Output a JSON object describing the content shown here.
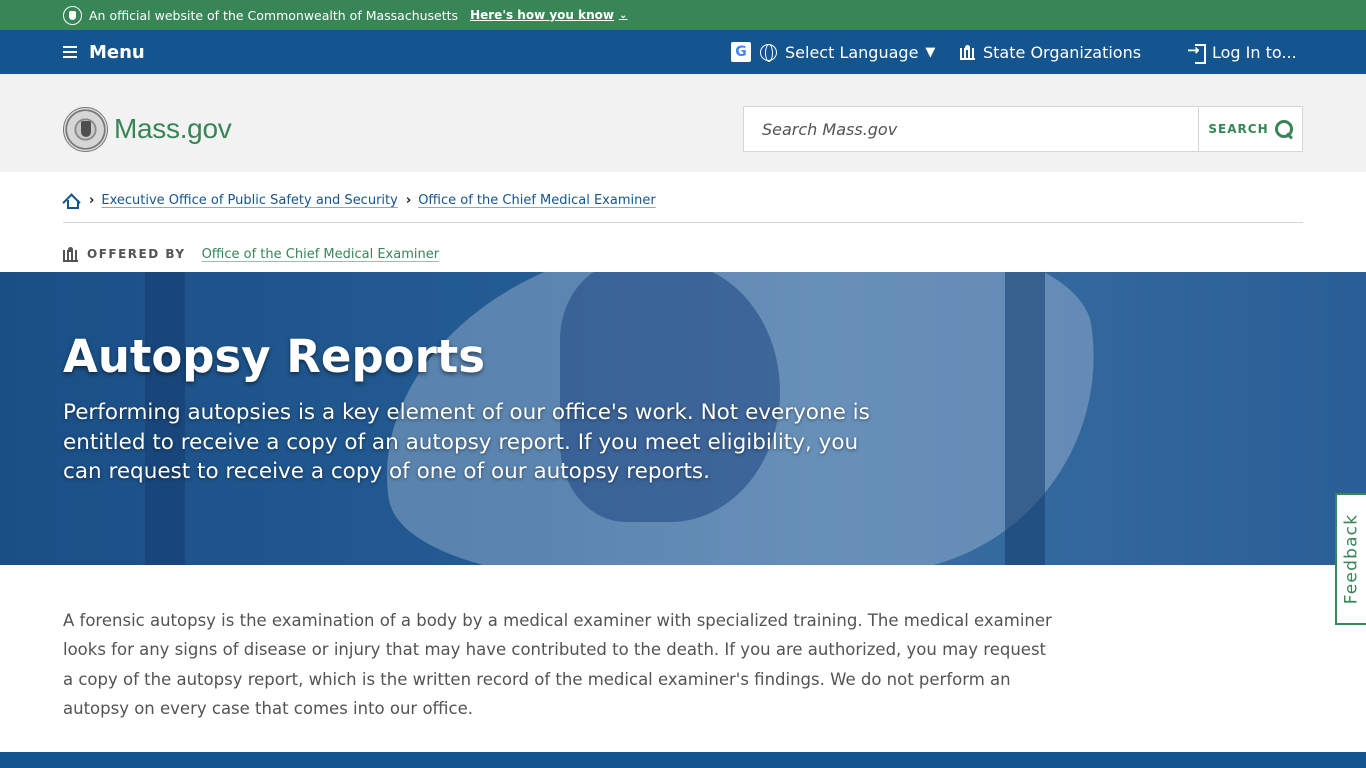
{
  "official_banner": {
    "text": "An official website of the Commonwealth of Massachusetts",
    "link": "Here's how you know"
  },
  "utility_nav": {
    "menu": "Menu",
    "language": "Select Language",
    "state_orgs": "State Organizations",
    "login": "Log In to..."
  },
  "header": {
    "logo_text": "Mass.gov",
    "search_placeholder": "Search Mass.gov",
    "search_button": "SEARCH"
  },
  "breadcrumb": {
    "items": [
      "Executive Office of Public Safety and Security",
      "Office of the Chief Medical Examiner"
    ]
  },
  "offered_by": {
    "label": "OFFERED BY",
    "org": "Office of the Chief Medical Examiner"
  },
  "hero": {
    "title": "Autopsy Reports",
    "subtitle": "Performing autopsies is a key element of our office's work. Not everyone is entitled to receive a copy of an autopsy report. If you meet eligibility, you can request to receive a copy of one of our autopsy reports."
  },
  "body": {
    "paragraph": "A forensic autopsy is the examination of a body by a medical examiner with specialized training. The medical examiner looks for any signs of disease or injury that may have contributed to the death. If you are authorized, you may request a copy of the autopsy report, which is the written record of the medical examiner's findings. We do not perform an autopsy on every case that comes into our office."
  },
  "feedback": {
    "label": "Feedback"
  },
  "colors": {
    "green": "#388557",
    "blue": "#14558f"
  }
}
